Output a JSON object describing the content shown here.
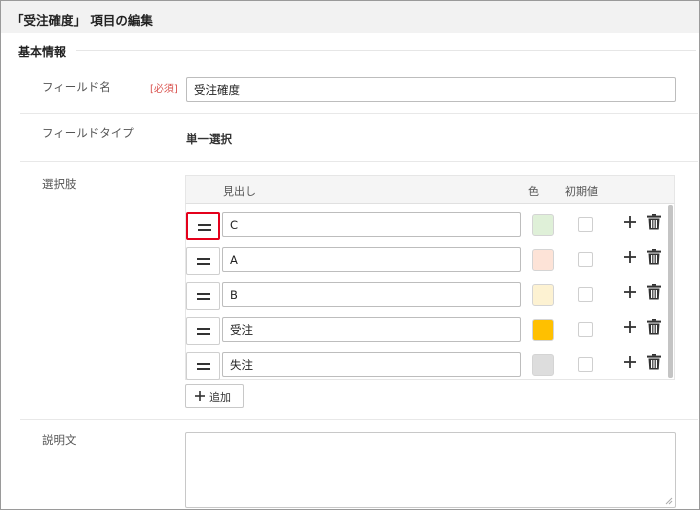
{
  "header": {
    "title": "「受注確度」 項目の編集"
  },
  "section": {
    "title": "基本情報"
  },
  "field_name": {
    "label": "フィールド名",
    "required": "[必須]",
    "value": "受注確度"
  },
  "field_type": {
    "label": "フィールドタイプ",
    "value": "単一選択"
  },
  "choices": {
    "label": "選択肢",
    "headers": {
      "heading": "見出し",
      "color": "色",
      "default": "初期値"
    },
    "rows": [
      {
        "label": "C",
        "color": "#dff0d8",
        "checked": false
      },
      {
        "label": "A",
        "color": "#fde3d7",
        "checked": false
      },
      {
        "label": "B",
        "color": "#fdf2d2",
        "checked": false
      },
      {
        "label": "受注",
        "color": "#ffc000",
        "checked": false
      },
      {
        "label": "失注",
        "color": "#dddddd",
        "checked": false
      }
    ],
    "highlighted_row": 0,
    "add_label": "追加"
  },
  "description": {
    "label": "説明文",
    "value": ""
  }
}
